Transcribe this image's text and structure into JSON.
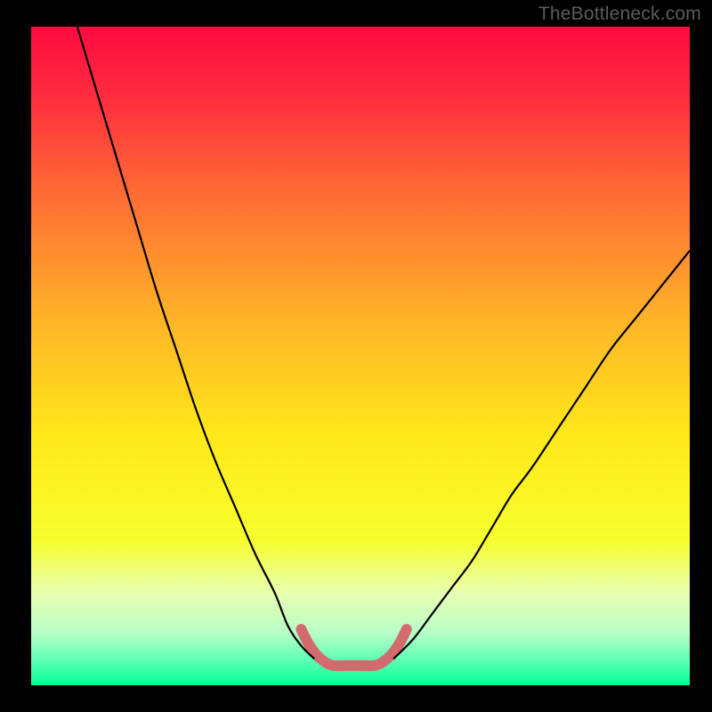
{
  "watermark": "TheBottleneck.com",
  "chart_data": {
    "type": "line",
    "title": "",
    "xlabel": "",
    "ylabel": "",
    "xlim": [
      0,
      100
    ],
    "ylim": [
      0,
      100
    ],
    "grid": false,
    "legend": false,
    "annotations": [],
    "background_gradient": {
      "stops": [
        {
          "offset": 0.0,
          "color": "#ff0b41"
        },
        {
          "offset": 0.1,
          "color": "#ff2a3f"
        },
        {
          "offset": 0.25,
          "color": "#ff6a35"
        },
        {
          "offset": 0.45,
          "color": "#ffb528"
        },
        {
          "offset": 0.62,
          "color": "#ffe81a"
        },
        {
          "offset": 0.78,
          "color": "#f6ff2e"
        },
        {
          "offset": 0.86,
          "color": "#e8ffb0"
        },
        {
          "offset": 0.92,
          "color": "#b8ffc8"
        },
        {
          "offset": 0.97,
          "color": "#4cffb0"
        },
        {
          "offset": 1.0,
          "color": "#00ff94"
        }
      ]
    },
    "series": [
      {
        "name": "curve-left",
        "color": "#000000",
        "width": 2.2,
        "x": [
          7,
          10,
          13,
          16,
          19,
          22,
          25,
          28,
          31,
          34,
          37,
          39,
          41,
          43
        ],
        "y": [
          100,
          90,
          80,
          70,
          60,
          51,
          42,
          34,
          27,
          20,
          14,
          9,
          6,
          4
        ]
      },
      {
        "name": "curve-right",
        "color": "#000000",
        "width": 2.2,
        "x": [
          55,
          58,
          61,
          64,
          67,
          70,
          73,
          76,
          80,
          84,
          88,
          92,
          96,
          100
        ],
        "y": [
          4,
          7,
          11,
          15,
          19,
          24,
          29,
          33,
          39,
          45,
          51,
          56,
          61,
          66
        ]
      },
      {
        "name": "highlight-bottom",
        "color": "#d36b6e",
        "width": 12,
        "cap": "round",
        "x": [
          41,
          42,
          43,
          44,
          45,
          46,
          48,
          50,
          52,
          53,
          54,
          55,
          56,
          57
        ],
        "y": [
          8.5,
          6.5,
          5.0,
          4.0,
          3.3,
          3.0,
          3.0,
          3.0,
          3.0,
          3.3,
          4.0,
          5.0,
          6.5,
          8.5
        ]
      }
    ]
  }
}
